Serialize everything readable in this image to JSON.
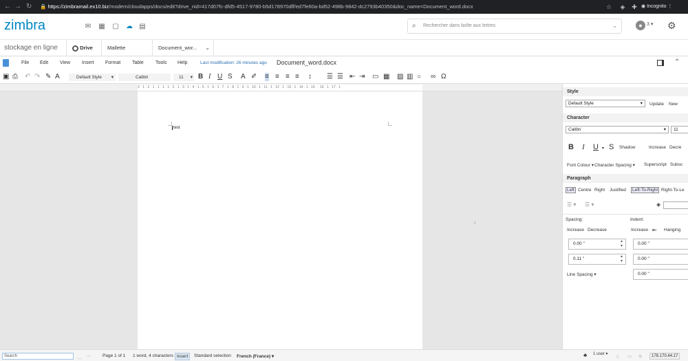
{
  "browser": {
    "url_host": "https://zimbramail.ex10.biz",
    "url_path": "/modern/cloudapps/docs/edit?drive_nid=417d07fc-dfd5-4517-9780-b5d178970dff/ed7fe60a-bd52-498b-9842-dc2793b40350&doc_name=Document_word.docx",
    "incognito_label": "Incognito"
  },
  "header": {
    "logo": "zimbra",
    "search_placeholder": "Rechercher dans boîte aux lettres",
    "avatar_count": "3"
  },
  "tabs": {
    "app_name": "stockage en ligne",
    "items": [
      {
        "label": "Drive"
      },
      {
        "label": "Mallette"
      },
      {
        "label": "Document_wor..."
      }
    ]
  },
  "menubar": {
    "items": [
      "File",
      "Edit",
      "View",
      "Insert",
      "Format",
      "Table",
      "Tools",
      "Help"
    ],
    "last_modification": "Last modification: 26 minutes ago",
    "doc_name": "Document_word.docx"
  },
  "toolbar": {
    "paragraph_style": "Default Style",
    "font_name": "Calibri",
    "font_size": "11"
  },
  "ruler": {
    "marks": "3 · 1 · 2 · 1 · 1 · 1 · 1 · 2 · 1 · 3 · 1 · 4 · 1 · 5 · 1 · 6 · 1 · 7 · 1 · 8 · 1 · 9 · 1 · 10 · 1 · 11 · 1 · 12 · 1 · 13 · 1 · 14 · 1 · 15 · · 16 · 1 · 17 · 1"
  },
  "document": {
    "text": "test"
  },
  "sidebar": {
    "style_header": "Style",
    "style_value": "Default Style",
    "update_label": "Update",
    "new_label": "New",
    "character_header": "Character",
    "font_value": "Calibri",
    "size_value": "11",
    "shadow_label": "Shadow",
    "increase_label": "Increase",
    "decrease_label": "Decre",
    "font_colour_label": "Font Colour",
    "char_spacing_label": "Character Spacing",
    "superscript_label": "Superscript",
    "subscript_label": "Subsc",
    "paragraph_header": "Paragraph",
    "align_left": "Left",
    "align_centre": "Centre",
    "align_right": "Right",
    "align_justified": "Justified",
    "ltr_label": "Left-To-Right",
    "rtl_label": "Right-To-Le",
    "spacing_label": "Spacing:",
    "indent_label": "Indent:",
    "sp_increase": "Increase",
    "sp_decrease": "Decrease",
    "in_increase": "Increase",
    "in_hanging": "Hanging",
    "above_value": "0.00 \"",
    "below_value": "0.11 \"",
    "indent_before": "0.00 \"",
    "indent_after": "0.00 \"",
    "line_spacing_label": "Line Spacing",
    "first_line": "0.00 \""
  },
  "status": {
    "search_value": "Search",
    "page": "Page 1 of 1",
    "words": "1 word, 4 characters",
    "mode": "Insert",
    "selection": "Standard selection",
    "language": "French (France)",
    "user": "1 user",
    "ip": "178.170.44.17"
  }
}
